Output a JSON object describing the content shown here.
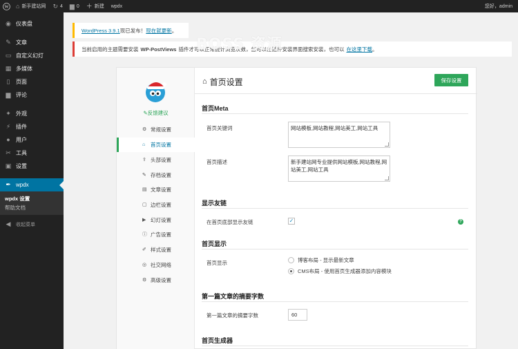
{
  "admin_bar": {
    "site_name": "新手建站网",
    "updates_count": "4",
    "comments_count": "0",
    "new_label": "新建",
    "theme_label": "wpdx",
    "greeting": "您好，admin"
  },
  "sidebar": {
    "items": [
      {
        "label": "仪表盘",
        "icon": "dashboard-icon",
        "glyph": "◉"
      },
      {
        "label": "文章",
        "icon": "pin-icon",
        "glyph": "✎"
      },
      {
        "label": "自定义幻灯",
        "icon": "slides-icon",
        "glyph": "▭"
      },
      {
        "label": "多媒体",
        "icon": "media-icon",
        "glyph": "▦"
      },
      {
        "label": "页面",
        "icon": "page-icon",
        "glyph": "▯"
      },
      {
        "label": "评论",
        "icon": "comment-icon",
        "glyph": "▆"
      },
      {
        "label": "外观",
        "icon": "appearance-icon",
        "glyph": "✦"
      },
      {
        "label": "插件",
        "icon": "plugin-icon",
        "glyph": "⚡"
      },
      {
        "label": "用户",
        "icon": "user-icon",
        "glyph": "●"
      },
      {
        "label": "工具",
        "icon": "tools-icon",
        "glyph": "✂"
      },
      {
        "label": "设置",
        "icon": "settings-icon",
        "glyph": "▣"
      },
      {
        "label": "wpdx",
        "icon": "wpdx-icon",
        "glyph": "✒"
      }
    ],
    "submenu": [
      "wpdx 设置",
      "帮助文档"
    ],
    "collapse_label": "收起菜单"
  },
  "notices": {
    "update_version": "WordPress 3.9.1",
    "update_text": "现已发布！",
    "update_link": "现在就更新",
    "update_end": "。",
    "plugin_prefix": "当前启用的主题需要安装",
    "plugin_name": "WP-PostViews",
    "plugin_middle": "插件才可以正常统计浏览次数，您可以在插件安装界面搜索安装，也可以",
    "plugin_link": "在这里下载",
    "plugin_end": "。"
  },
  "watermark": "BOSS 资源",
  "panel": {
    "feedback_label": "反馈建议",
    "nav": [
      {
        "label": "常规设置",
        "icon": "gear-icon",
        "glyph": "⚙"
      },
      {
        "label": "首页设置",
        "icon": "home-icon",
        "glyph": "⌂"
      },
      {
        "label": "头部设置",
        "icon": "upload-icon",
        "glyph": "⇪"
      },
      {
        "label": "存档设置",
        "icon": "edit-icon",
        "glyph": "✎"
      },
      {
        "label": "文章设置",
        "icon": "document-icon",
        "glyph": "▤"
      },
      {
        "label": "边栏设置",
        "icon": "sidebar-icon",
        "glyph": "▢"
      },
      {
        "label": "幻灯设置",
        "icon": "play-icon",
        "glyph": "▶"
      },
      {
        "label": "广告设置",
        "icon": "info-icon",
        "glyph": "ⓘ"
      },
      {
        "label": "样式设置",
        "icon": "brush-icon",
        "glyph": "✐"
      },
      {
        "label": "社交网络",
        "icon": "share-icon",
        "glyph": "◎"
      },
      {
        "label": "高级设置",
        "icon": "cogs-icon",
        "glyph": "⚙"
      }
    ],
    "title": "首页设置",
    "save_label": "保存设置",
    "sections": {
      "meta_title": "首页Meta",
      "keywords_label": "首页关键词",
      "keywords_value": "网站模板,网站教程,网站美工,网站工具",
      "description_label": "首页描述",
      "description_value": "新手建站网专业提供网站模板,网站教程,网站美工,网站工具",
      "links_title": "显示友链",
      "links_label": "在首页底部显示友链",
      "links_checked": "✓",
      "display_title": "首页显示",
      "display_label": "首页显示",
      "display_option1": "博客布局 - 显示最新文章",
      "display_option2": "CMS布局 - 使用首页生成器添加内容模块",
      "excerpt_title": "第一篇文章的摘要字数",
      "excerpt_label": "第一篇文章的摘要字数",
      "excerpt_value": "60",
      "builder_title": "首页生成器"
    }
  },
  "colors": {
    "admin_bar": "#222222",
    "current_menu": "#0074a2",
    "accent_green": "#2ea65a",
    "notice_yellow": "#ffba00",
    "notice_red": "#dd3d36"
  }
}
